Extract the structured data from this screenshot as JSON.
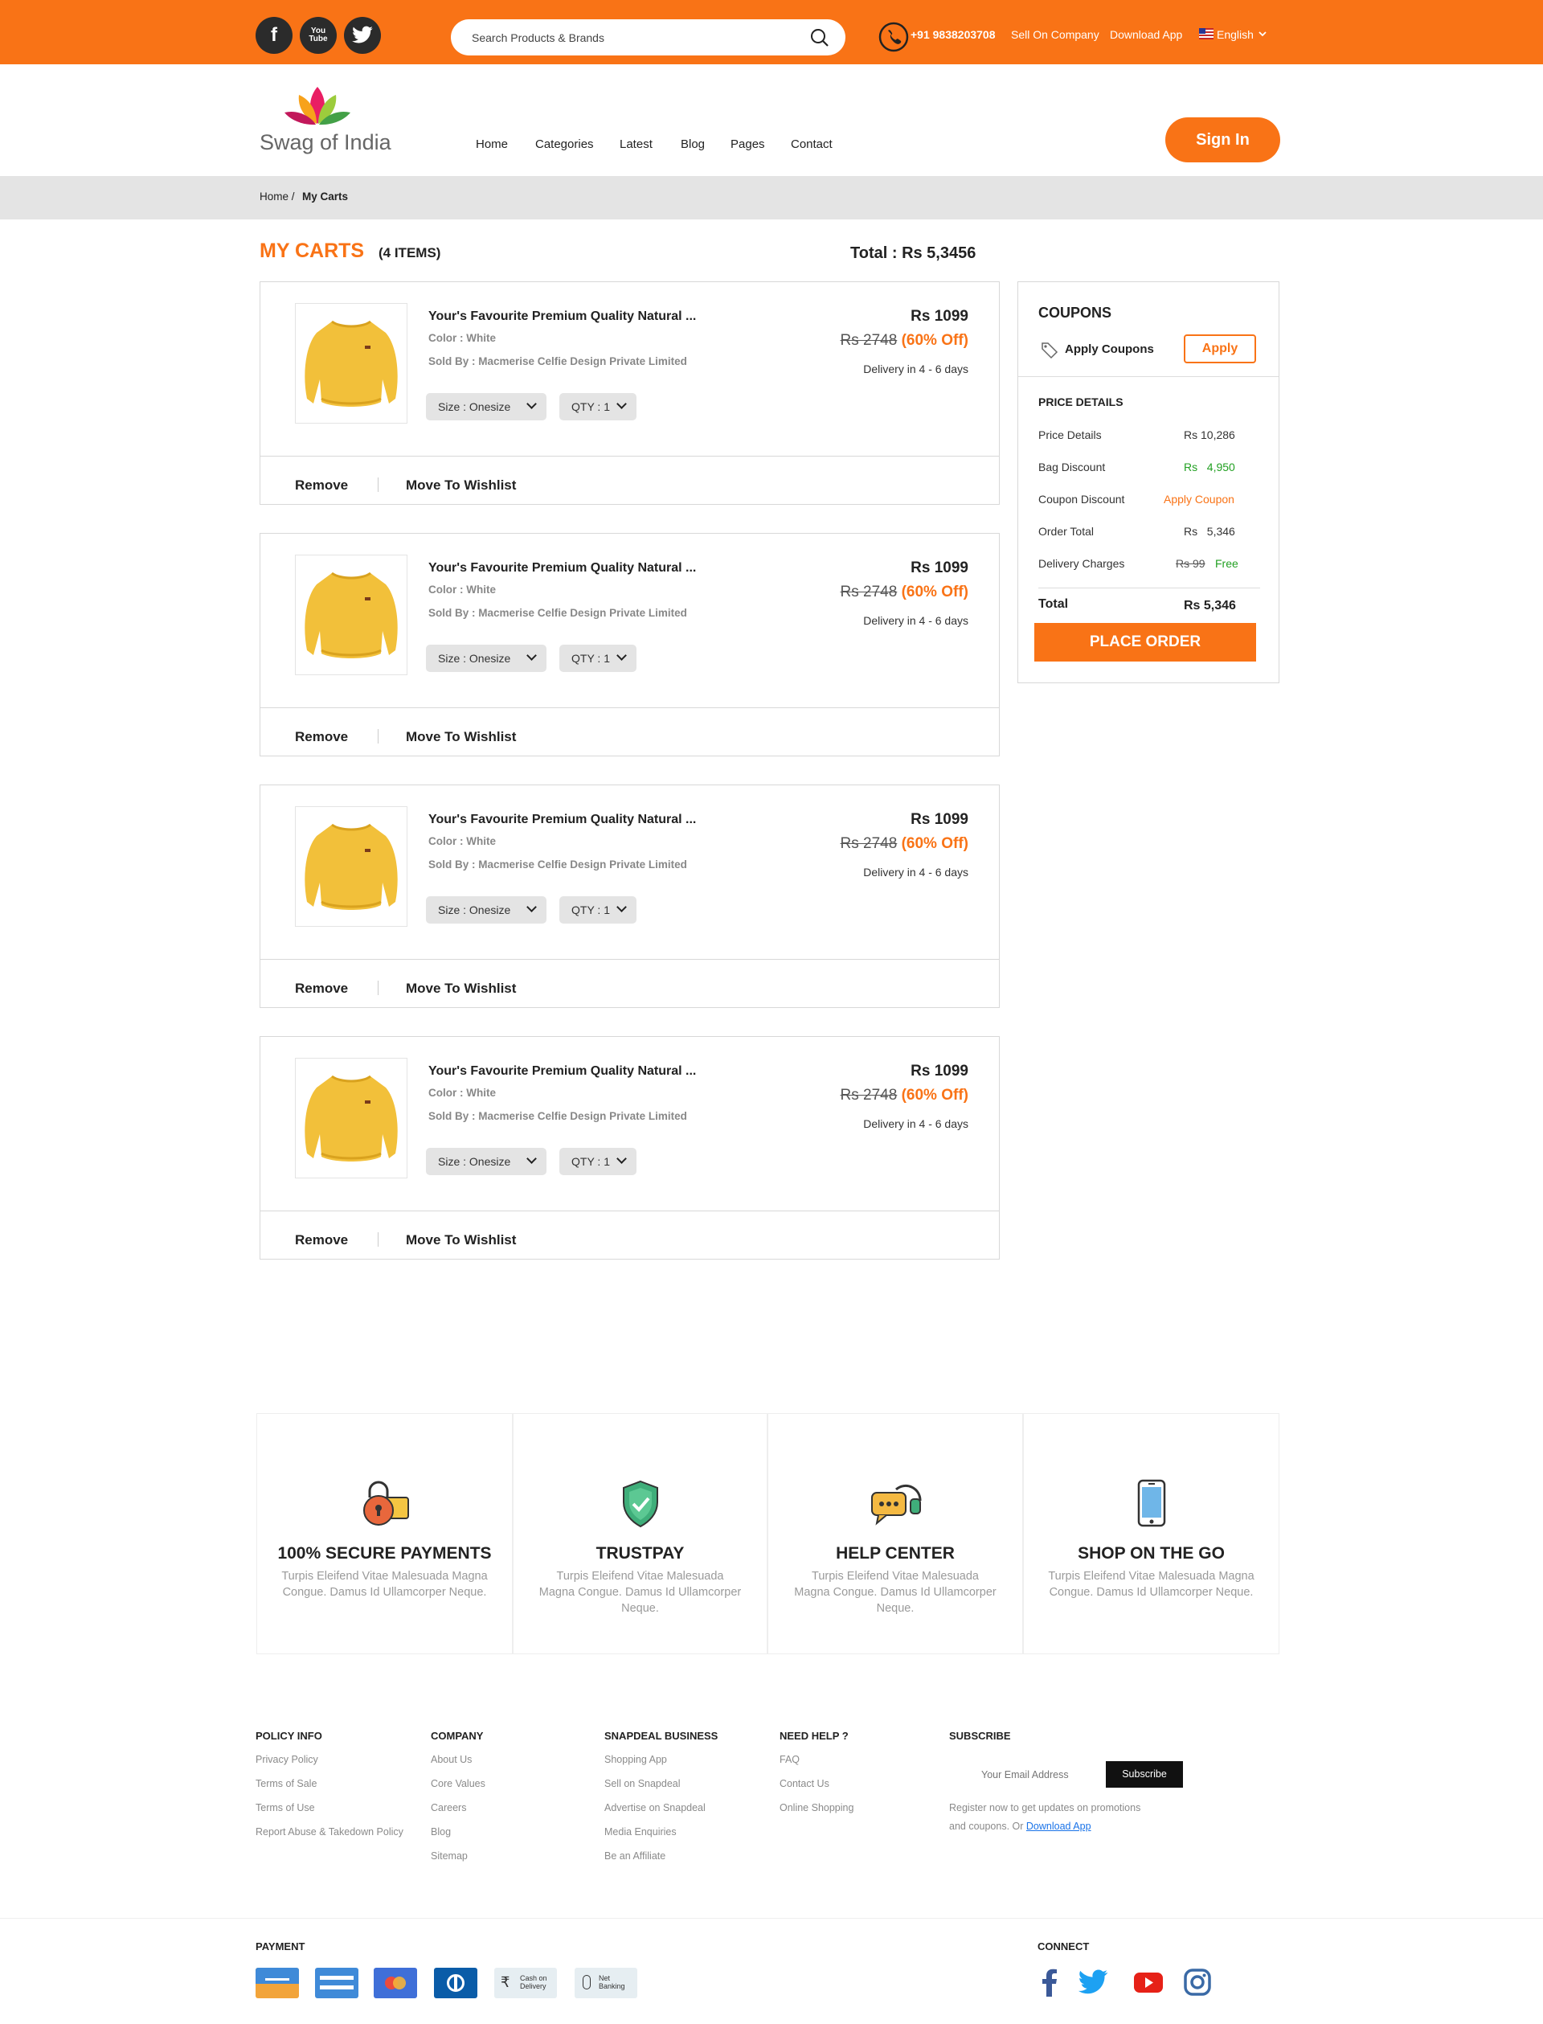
{
  "topbar": {
    "social": [
      {
        "icon": "facebook-icon",
        "glyph": "f"
      },
      {
        "icon": "youtube-icon",
        "glyph": "You\nTube"
      },
      {
        "icon": "twitter-icon",
        "glyph": ""
      }
    ],
    "search_placeholder": "Search Products & Brands",
    "phone": "+91 9838203708",
    "sell": "Sell On Company",
    "download": "Download App",
    "language": "English",
    "accent": "#f97316"
  },
  "header": {
    "logo_text": "Swag of India",
    "nav": [
      "Home",
      "Categories",
      "Latest",
      "Blog",
      "Pages",
      "Contact"
    ],
    "signin": "Sign In"
  },
  "breadcrumb": {
    "home": "Home /",
    "current": "My Carts"
  },
  "cart": {
    "title": "MY CARTS",
    "count": "(4 ITEMS)",
    "total": "Total : Rs 5,3456",
    "items": [
      {
        "title": "Your's Favourite Premium Quality Natural ...",
        "color": "Color : White",
        "seller": "Sold By : Macmerise Celfie Design Private Limited",
        "size": "Size : Onesize",
        "qty": "QTY : 1",
        "price": "Rs 1099",
        "mrp": "Rs 2748",
        "off": " (60% Off)",
        "delivery": "Delivery in 4 - 6 days",
        "remove": "Remove",
        "wishlist": "Move To Wishlist"
      },
      {
        "title": "Your's Favourite Premium Quality Natural ...",
        "color": "Color : White",
        "seller": "Sold By : Macmerise Celfie Design Private Limited",
        "size": "Size : Onesize",
        "qty": "QTY : 1",
        "price": "Rs 1099",
        "mrp": "Rs 2748",
        "off": " (60% Off)",
        "delivery": "Delivery in 4 - 6 days",
        "remove": "Remove",
        "wishlist": "Move To Wishlist"
      },
      {
        "title": "Your's Favourite Premium Quality Natural ...",
        "color": "Color : White",
        "seller": "Sold By : Macmerise Celfie Design Private Limited",
        "size": "Size : Onesize",
        "qty": "QTY : 1",
        "price": "Rs 1099",
        "mrp": "Rs 2748",
        "off": " (60% Off)",
        "delivery": "Delivery in 4 - 6 days",
        "remove": "Remove",
        "wishlist": "Move To Wishlist"
      },
      {
        "title": "Your's Favourite Premium Quality Natural ...",
        "color": "Color : White",
        "seller": "Sold By : Macmerise Celfie Design Private Limited",
        "size": "Size : Onesize",
        "qty": "QTY : 1",
        "price": "Rs 1099",
        "mrp": "Rs 2748",
        "off": " (60% Off)",
        "delivery": "Delivery in 4 - 6 days",
        "remove": "Remove",
        "wishlist": "Move To Wishlist"
      }
    ]
  },
  "coupons": {
    "title": "COUPONS",
    "apply_label": "Apply Coupons",
    "apply_button": "Apply",
    "price_details_title": "PRICE DETAILS",
    "rows": [
      {
        "label": "Price Details",
        "value": "Rs 10,286"
      },
      {
        "label": "Bag Discount",
        "value": "Rs   4,950"
      },
      {
        "label": "Coupon Discount",
        "value": "Apply Coupon"
      },
      {
        "label": "Order Total",
        "value": "Rs   5,346"
      },
      {
        "label": "Delivery Charges",
        "old": "Rs 99 ",
        "value": "Free"
      }
    ],
    "total_label": "Total",
    "total_value": "Rs 5,346",
    "place_order": "PLACE ORDER",
    "green": "#22a022"
  },
  "features": [
    {
      "icon": "secure-payment-icon",
      "title": "100% SECURE PAYMENTS",
      "desc": "Turpis Eleifend Vitae Malesuada Magna Congue. Damus Id Ullamcorper Neque."
    },
    {
      "icon": "trustpay-shield-icon",
      "title": "TRUSTPAY",
      "desc": "Turpis Eleifend Vitae Malesuada Magna Congue. Damus Id Ullamcorper Neque."
    },
    {
      "icon": "help-center-icon",
      "title": "HELP CENTER",
      "desc": "Turpis Eleifend Vitae Malesuada Magna Congue. Damus Id Ullamcorper Neque."
    },
    {
      "icon": "mobile-phone-icon",
      "title": "SHOP ON THE GO",
      "desc": "Turpis Eleifend Vitae Malesuada Magna Congue. Damus Id Ullamcorper Neque."
    }
  ],
  "footer": {
    "policy": {
      "title": "POLICY INFO",
      "links": [
        "Privacy Policy",
        "Terms of Sale",
        "Terms of Use",
        "Report Abuse & Takedown Policy"
      ]
    },
    "company": {
      "title": "COMPANY",
      "links": [
        "About Us",
        "Core Values",
        "Careers",
        "Blog",
        "Sitemap"
      ]
    },
    "business": {
      "title": "SNAPDEAL BUSINESS",
      "links": [
        "Shopping App",
        "Sell on Snapdeal",
        "Advertise on Snapdeal",
        "Media Enquiries",
        "Be an Affiliate"
      ]
    },
    "help": {
      "title": "NEED HELP ?",
      "links": [
        "FAQ",
        "Contact Us",
        "Online Shopping"
      ]
    },
    "subscribe": {
      "title": "SUBSCRIBE",
      "placeholder": "Your Email Address",
      "button": "Subscribe",
      "note1": "Register now to get updates on promotions",
      "note2": "and coupons. Or ",
      "link": "Download App"
    },
    "payment_title": "PAYMENT",
    "payments": [
      {
        "icon": "card-icon"
      },
      {
        "icon": "card-icon"
      },
      {
        "icon": "mastercard-icon"
      },
      {
        "icon": "diners-club-icon"
      },
      {
        "icon": "cash-on-delivery-icon",
        "label1": "Cash on",
        "label2": "Delivery"
      },
      {
        "icon": "net-banking-icon",
        "label1": "Net",
        "label2": "Banking"
      }
    ],
    "connect_title": "CONNECT"
  }
}
